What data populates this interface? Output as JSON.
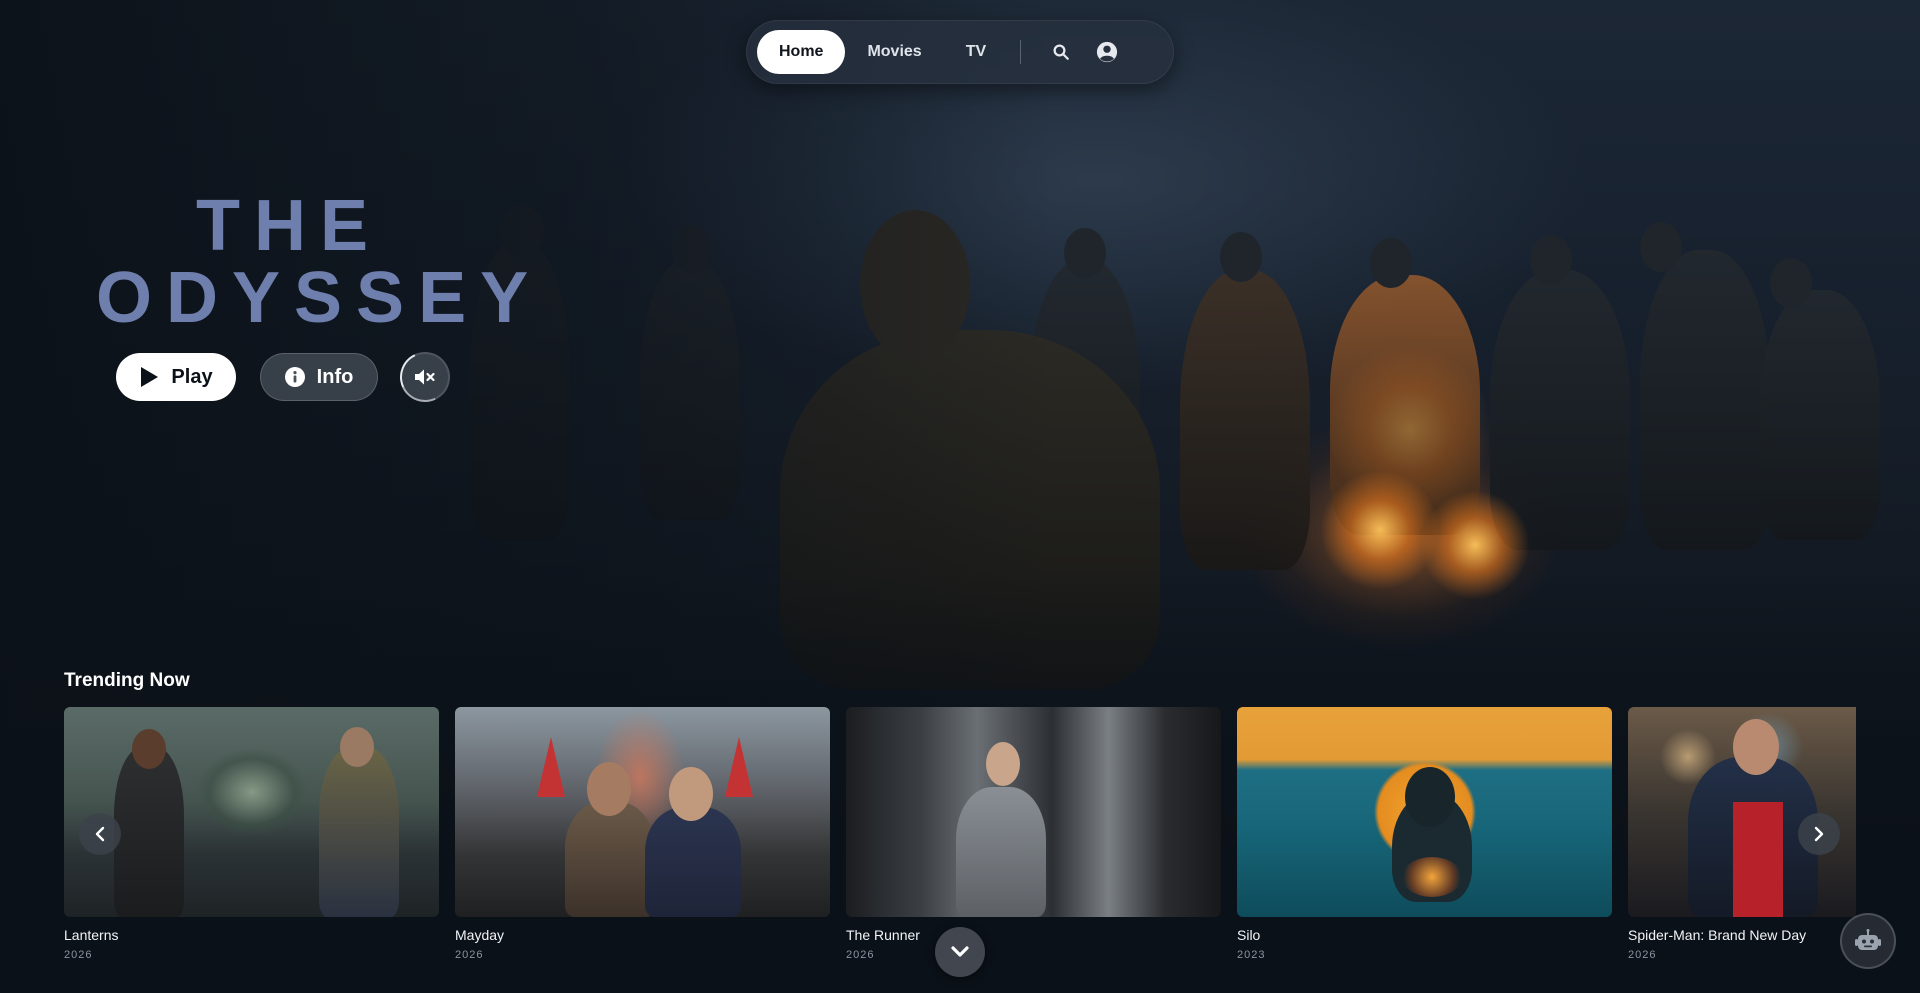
{
  "nav": {
    "items": [
      {
        "label": "Home",
        "active": true
      },
      {
        "label": "Movies",
        "active": false
      },
      {
        "label": "TV",
        "active": false
      }
    ],
    "search_icon": "search-icon",
    "profile_icon": "user-circle-icon"
  },
  "hero": {
    "title_line1": "THE",
    "title_line2": "ODYSSEY",
    "play_label": "Play",
    "info_label": "Info",
    "mute_icon": "volume-mute-icon",
    "title_color": "#6e7fae"
  },
  "trending": {
    "title": "Trending Now",
    "items": [
      {
        "title": "Lanterns",
        "year": "2026"
      },
      {
        "title": "Mayday",
        "year": "2026"
      },
      {
        "title": "The Runner",
        "year": "2026"
      },
      {
        "title": "Silo",
        "year": "2023"
      },
      {
        "title": "Spider-Man: Brand New Day",
        "year": "2026"
      }
    ]
  },
  "controls": {
    "prev_icon": "chevron-left-icon",
    "next_icon": "chevron-right-icon",
    "scroll_down_icon": "chevron-down-icon",
    "assistant_icon": "robot-icon"
  }
}
